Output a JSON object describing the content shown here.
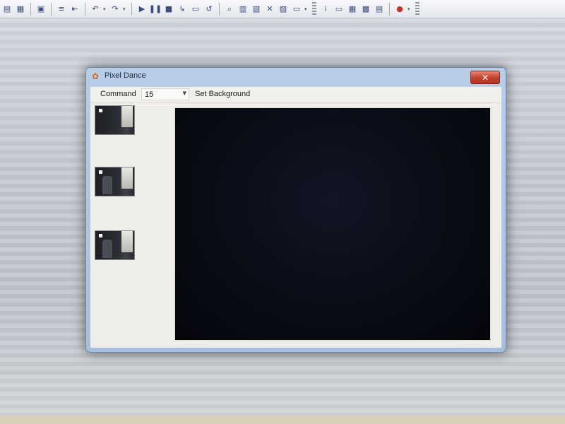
{
  "ide_toolbar": {
    "icons": [
      "properties-icon",
      "layout-icon",
      "print-preview-icon",
      "align-icon",
      "outdent-icon",
      "undo-icon",
      "redo-icon",
      "run-icon",
      "pause-icon",
      "stop-icon",
      "step-icon",
      "watch-icon",
      "breakpoint-icon",
      "find-icon",
      "explorer-icon",
      "properties-window-icon",
      "toolbox-icon",
      "tools-icon",
      "window-icon",
      "grid-icon",
      "form-icon",
      "table-icon",
      "chart-icon",
      "data-icon",
      "record-icon"
    ]
  },
  "window": {
    "title": "Pixel Dance",
    "close_glyph": "✕"
  },
  "toolstrip": {
    "command_label": "Command",
    "command_value": "15",
    "set_background_label": "Set Background"
  },
  "thumbnails": [
    {
      "name": "frame-1"
    },
    {
      "name": "frame-2"
    },
    {
      "name": "frame-3"
    }
  ]
}
